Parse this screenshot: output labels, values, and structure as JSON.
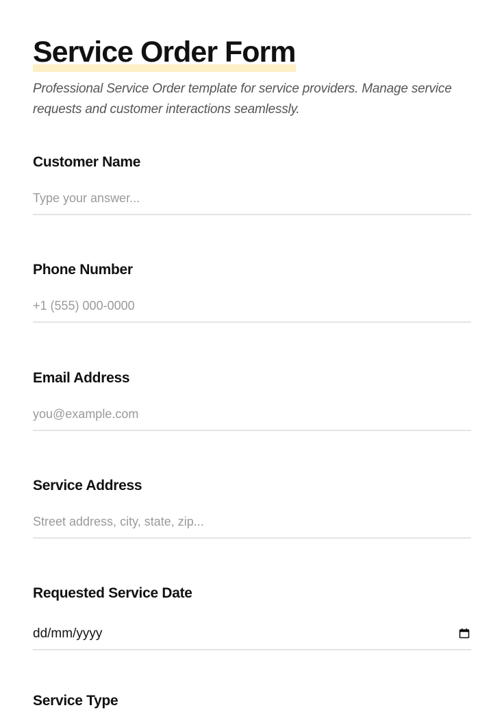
{
  "form": {
    "title": "Service Order Form",
    "subtitle": "Professional Service Order template for service providers. Manage service requests and customer interactions seamlessly."
  },
  "fields": [
    {
      "label": "Customer Name",
      "placeholder": "Type your answer...",
      "value": ""
    },
    {
      "label": "Phone Number",
      "placeholder": "+1 (555) 000-0000",
      "value": ""
    },
    {
      "label": "Email Address",
      "placeholder": "you@example.com",
      "value": ""
    },
    {
      "label": "Service Address",
      "placeholder": "Street address, city, state, zip...",
      "value": ""
    },
    {
      "label": "Requested Service Date",
      "value": "dd/mm/yyyy",
      "icon": "calendar-icon"
    },
    {
      "label": "Service Type"
    }
  ],
  "colors": {
    "title_highlight": "#fdefc6",
    "text": "#111111",
    "subtitle": "#555555",
    "placeholder": "#9a9a9a",
    "divider": "#e4e4e4"
  }
}
